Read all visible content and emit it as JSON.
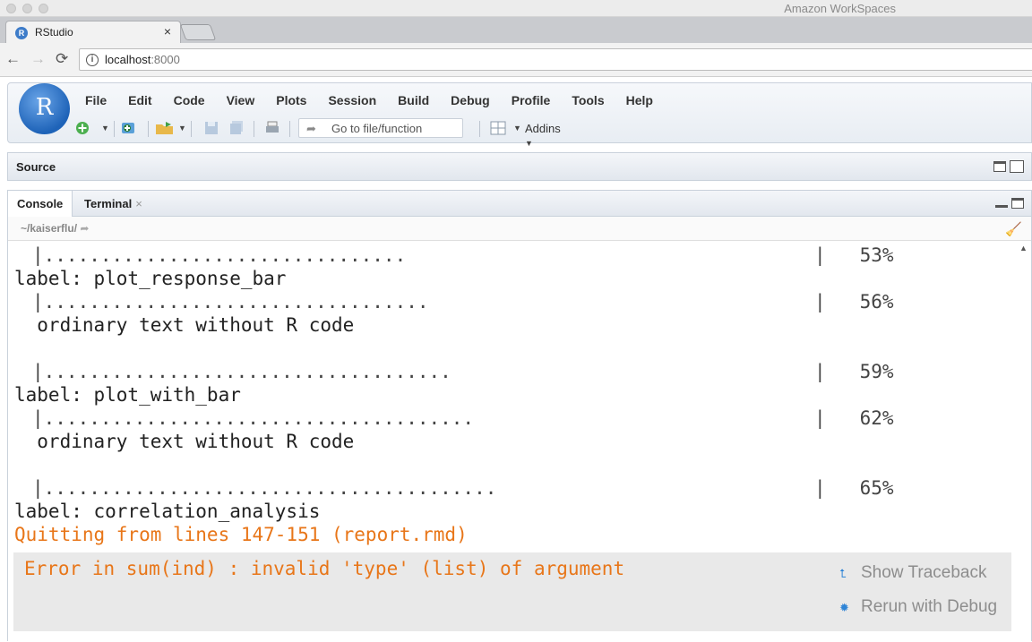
{
  "window": {
    "title": "Amazon WorkSpaces"
  },
  "browser": {
    "tab_title": "RStudio",
    "tab_close": "×",
    "url_host": "localhost",
    "url_port": ":8000",
    "nav_icons": [
      "back-arrow-icon",
      "forward-arrow-icon",
      "reload-icon"
    ]
  },
  "rstudio": {
    "menu": [
      "File",
      "Edit",
      "Code",
      "View",
      "Plots",
      "Session",
      "Build",
      "Debug",
      "Profile",
      "Tools",
      "Help"
    ],
    "goto_placeholder": "Go to file/function",
    "addins_label": "Addins",
    "logo_letter": "R"
  },
  "source_pane": {
    "title": "Source"
  },
  "console_pane": {
    "tabs": [
      {
        "label": "Console"
      },
      {
        "label": "Terminal",
        "close": "×"
      }
    ],
    "path": "~/kaiserflu/",
    "lines": [
      {
        "bar": "|................................",
        "pct": "|   53%"
      },
      {
        "text": "label: plot_response_bar"
      },
      {
        "bar": "|..................................",
        "pct": "|   56%"
      },
      {
        "text": "  ordinary text without R code"
      },
      {
        "bar": "|....................................",
        "pct": "|   59%"
      },
      {
        "text": "label: plot_with_bar"
      },
      {
        "bar": "|......................................",
        "pct": "|   62%"
      },
      {
        "text": "  ordinary text without R code"
      },
      {
        "bar": "|........................................",
        "pct": "|   65%"
      },
      {
        "text": "label: correlation_analysis"
      },
      {
        "text": "Quitting from lines 147-151 (report.rmd)"
      }
    ],
    "error": {
      "message": "Error in sum(ind) : invalid 'type' (list) of argument",
      "show_traceback": "Show Traceback",
      "rerun_debug": "Rerun with Debug"
    }
  },
  "colors": {
    "error_orange": "#e87619",
    "rstudio_blue": "#1e63b8"
  }
}
